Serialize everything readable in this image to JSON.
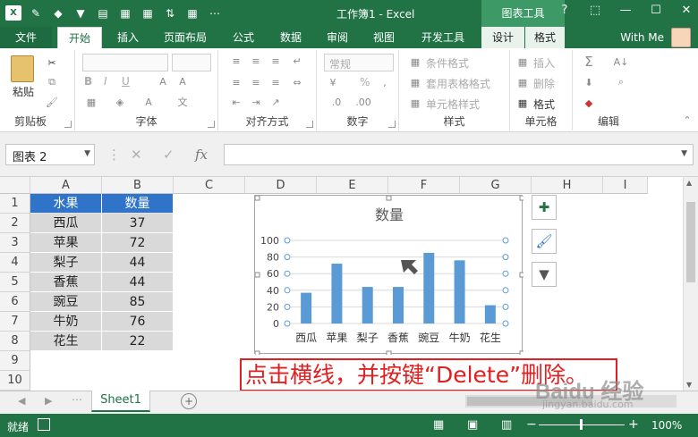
{
  "app": {
    "title": "工作簿1 - Excel",
    "context_tab_header": "图表工具"
  },
  "tabs": [
    "文件",
    "开始",
    "插入",
    "页面布局",
    "公式",
    "数据",
    "审阅",
    "视图",
    "开发工具",
    "设计",
    "格式"
  ],
  "user": {
    "name": "With Me"
  },
  "ribbon": {
    "clipboard": {
      "label": "剪贴板",
      "paste": "粘贴"
    },
    "font": {
      "label": "字体",
      "bold": "B",
      "italic": "I",
      "underline": "U"
    },
    "alignment": {
      "label": "对齐方式"
    },
    "number": {
      "label": "数字",
      "format": "常规",
      "percent": "%"
    },
    "styles": {
      "label": "样式",
      "conditional": "条件格式",
      "table": "套用表格格式",
      "cell": "单元格样式"
    },
    "cells": {
      "label": "单元格",
      "insert": "插入",
      "delete": "删除",
      "format": "格式"
    },
    "editing": {
      "label": "编辑"
    }
  },
  "formula_bar": {
    "name_box": "图表 2",
    "fx": "fx",
    "value": ""
  },
  "columns": [
    "A",
    "B",
    "C",
    "D",
    "E",
    "F",
    "G",
    "H",
    "I"
  ],
  "rows": [
    "1",
    "2",
    "3",
    "4",
    "5",
    "6",
    "7",
    "8",
    "9",
    "10"
  ],
  "table": {
    "headers": [
      "水果",
      "数量"
    ],
    "rows": [
      [
        "西瓜",
        "37"
      ],
      [
        "苹果",
        "72"
      ],
      [
        "梨子",
        "44"
      ],
      [
        "香蕉",
        "44"
      ],
      [
        "豌豆",
        "85"
      ],
      [
        "牛奶",
        "76"
      ],
      [
        "花生",
        "22"
      ]
    ]
  },
  "chart_data": {
    "type": "bar",
    "title": "数量",
    "categories": [
      "西瓜",
      "苹果",
      "梨子",
      "香蕉",
      "豌豆",
      "牛奶",
      "花生"
    ],
    "values": [
      37,
      72,
      44,
      44,
      85,
      76,
      22
    ],
    "yticks": [
      "0",
      "20",
      "40",
      "60",
      "80",
      "100"
    ],
    "ylim": [
      0,
      100
    ],
    "grid": true,
    "color": "#5b9bd5"
  },
  "chart_side_buttons": [
    "plus-icon",
    "brush-icon",
    "filter-icon"
  ],
  "annotation": "点击横线，并按键“Delete”删除。",
  "sheet": {
    "tab": "Sheet1"
  },
  "status": {
    "ready": "就绪",
    "zoom": "100%"
  },
  "watermark": {
    "brand": "Baidu 经验",
    "url": "jingyan.baidu.com"
  }
}
